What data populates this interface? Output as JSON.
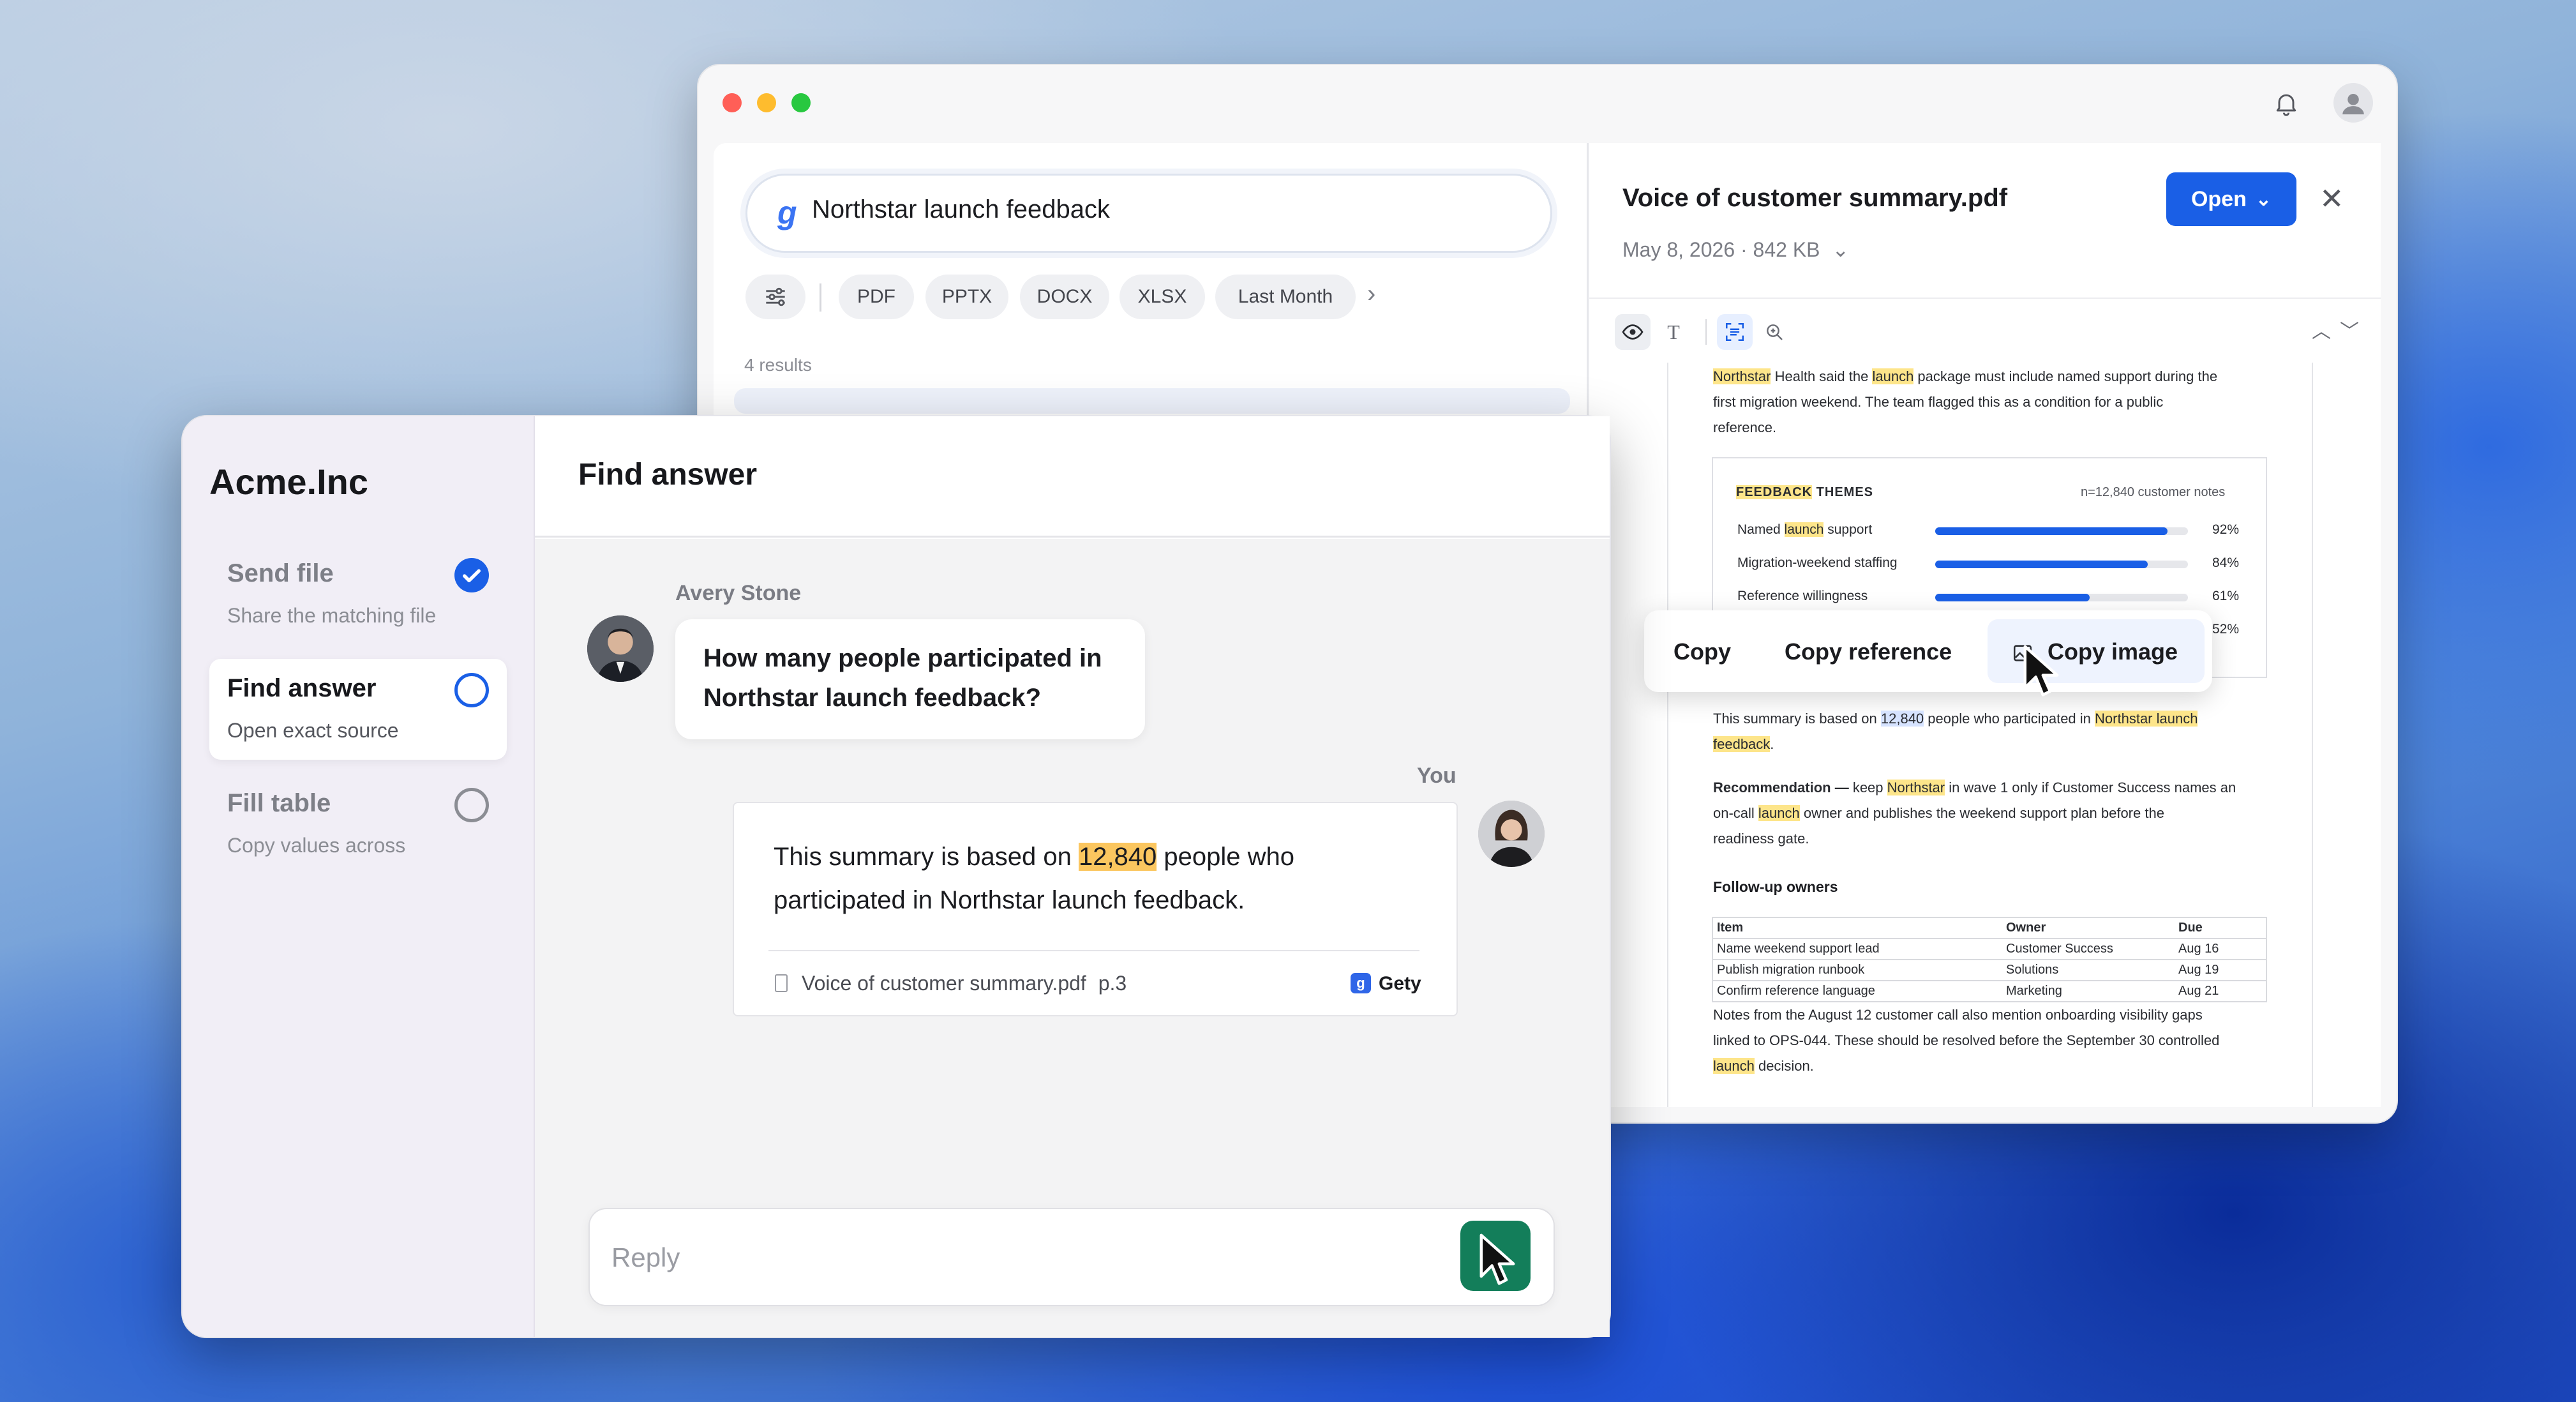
{
  "search": {
    "query": "Northstar launch feedback",
    "filters": [
      "PDF",
      "PPTX",
      "DOCX",
      "XLSX",
      "Last Month"
    ],
    "results_count": "4 results"
  },
  "viewer": {
    "title": "Voice of customer summary.pdf",
    "meta": "May 8, 2026 · 842 KB",
    "open_label": "Open",
    "intro": {
      "line1_a": "Northstar",
      "line1_b": " Health said the ",
      "line1_c": "launch",
      "line1_d": " package must include named support during the",
      "line2": "first migration weekend. The team flagged this as a condition for a public",
      "line3": "reference."
    },
    "themes": {
      "title_a": "FEEDBACK",
      "title_b": " THEMES",
      "n_label": "n=12,840 customer notes",
      "rows": [
        {
          "label_a": "Named ",
          "label_b": "launch",
          "label_c": " support",
          "value": 92,
          "pct": "92%"
        },
        {
          "label_a": "Migration-weekend staffing",
          "label_b": "",
          "label_c": "",
          "value": 84,
          "pct": "84%"
        },
        {
          "label_a": "Reference willingness",
          "label_b": "",
          "label_c": "",
          "value": 61,
          "pct": "61%"
        },
        {
          "label_a": "",
          "label_b": "",
          "label_c": "",
          "value": 52,
          "pct": "52%"
        }
      ]
    },
    "summary": {
      "a": "This summary is based on ",
      "b": "12,840",
      "c": " people who participated in ",
      "d": "Northstar launch",
      "e": "feedback",
      "f": "."
    },
    "recommendation": {
      "label": "Recommendation —",
      "a": " keep ",
      "b": "Northstar",
      "c": " in wave 1 only if Customer Success names an",
      "d": "on-call ",
      "e": "launch",
      "f": " owner and publishes the weekend support plan before the",
      "g": "readiness gate."
    },
    "owners": {
      "title": "Follow-up owners",
      "headers": [
        "Item",
        "Owner",
        "Due"
      ],
      "rows": [
        [
          "Name weekend support lead",
          "Customer Success",
          "Aug 16"
        ],
        [
          "Publish migration runbook",
          "Solutions",
          "Aug 19"
        ],
        [
          "Confirm reference language",
          "Marketing",
          "Aug 21"
        ]
      ]
    },
    "notes": {
      "line1": "Notes from the August 12 customer call also mention onboarding visibility gaps",
      "line2": "linked to OPS-044. These should be resolved before the September 30 controlled",
      "line3_a": "launch",
      "line3_b": " decision."
    },
    "context_menu": [
      "Copy",
      "Copy reference",
      "Copy image"
    ]
  },
  "app": {
    "brand": "Acme.Inc",
    "steps": [
      {
        "title": "Send file",
        "subtitle": "Share the matching file",
        "state": "done"
      },
      {
        "title": "Find answer",
        "subtitle": "Open exact source",
        "state": "active"
      },
      {
        "title": "Fill table",
        "subtitle": "Copy values across",
        "state": "pending"
      }
    ],
    "main_title": "Find answer",
    "question": {
      "sender": "Avery Stone",
      "text": "How many people participated in Northstar launch feedback?"
    },
    "answer": {
      "sender": "You",
      "text_a": "This summary is based on ",
      "highlight": "12,840",
      "text_b": " people who participated in Northstar launch feedback.",
      "source_file": "Voice of customer summary.pdf",
      "source_page": "p.3",
      "source_app": "Gety"
    },
    "reply_placeholder": "Reply"
  },
  "colors": {
    "accent": "#1a5fe6",
    "send": "#137e5a",
    "highlight": "#fbc65f"
  }
}
